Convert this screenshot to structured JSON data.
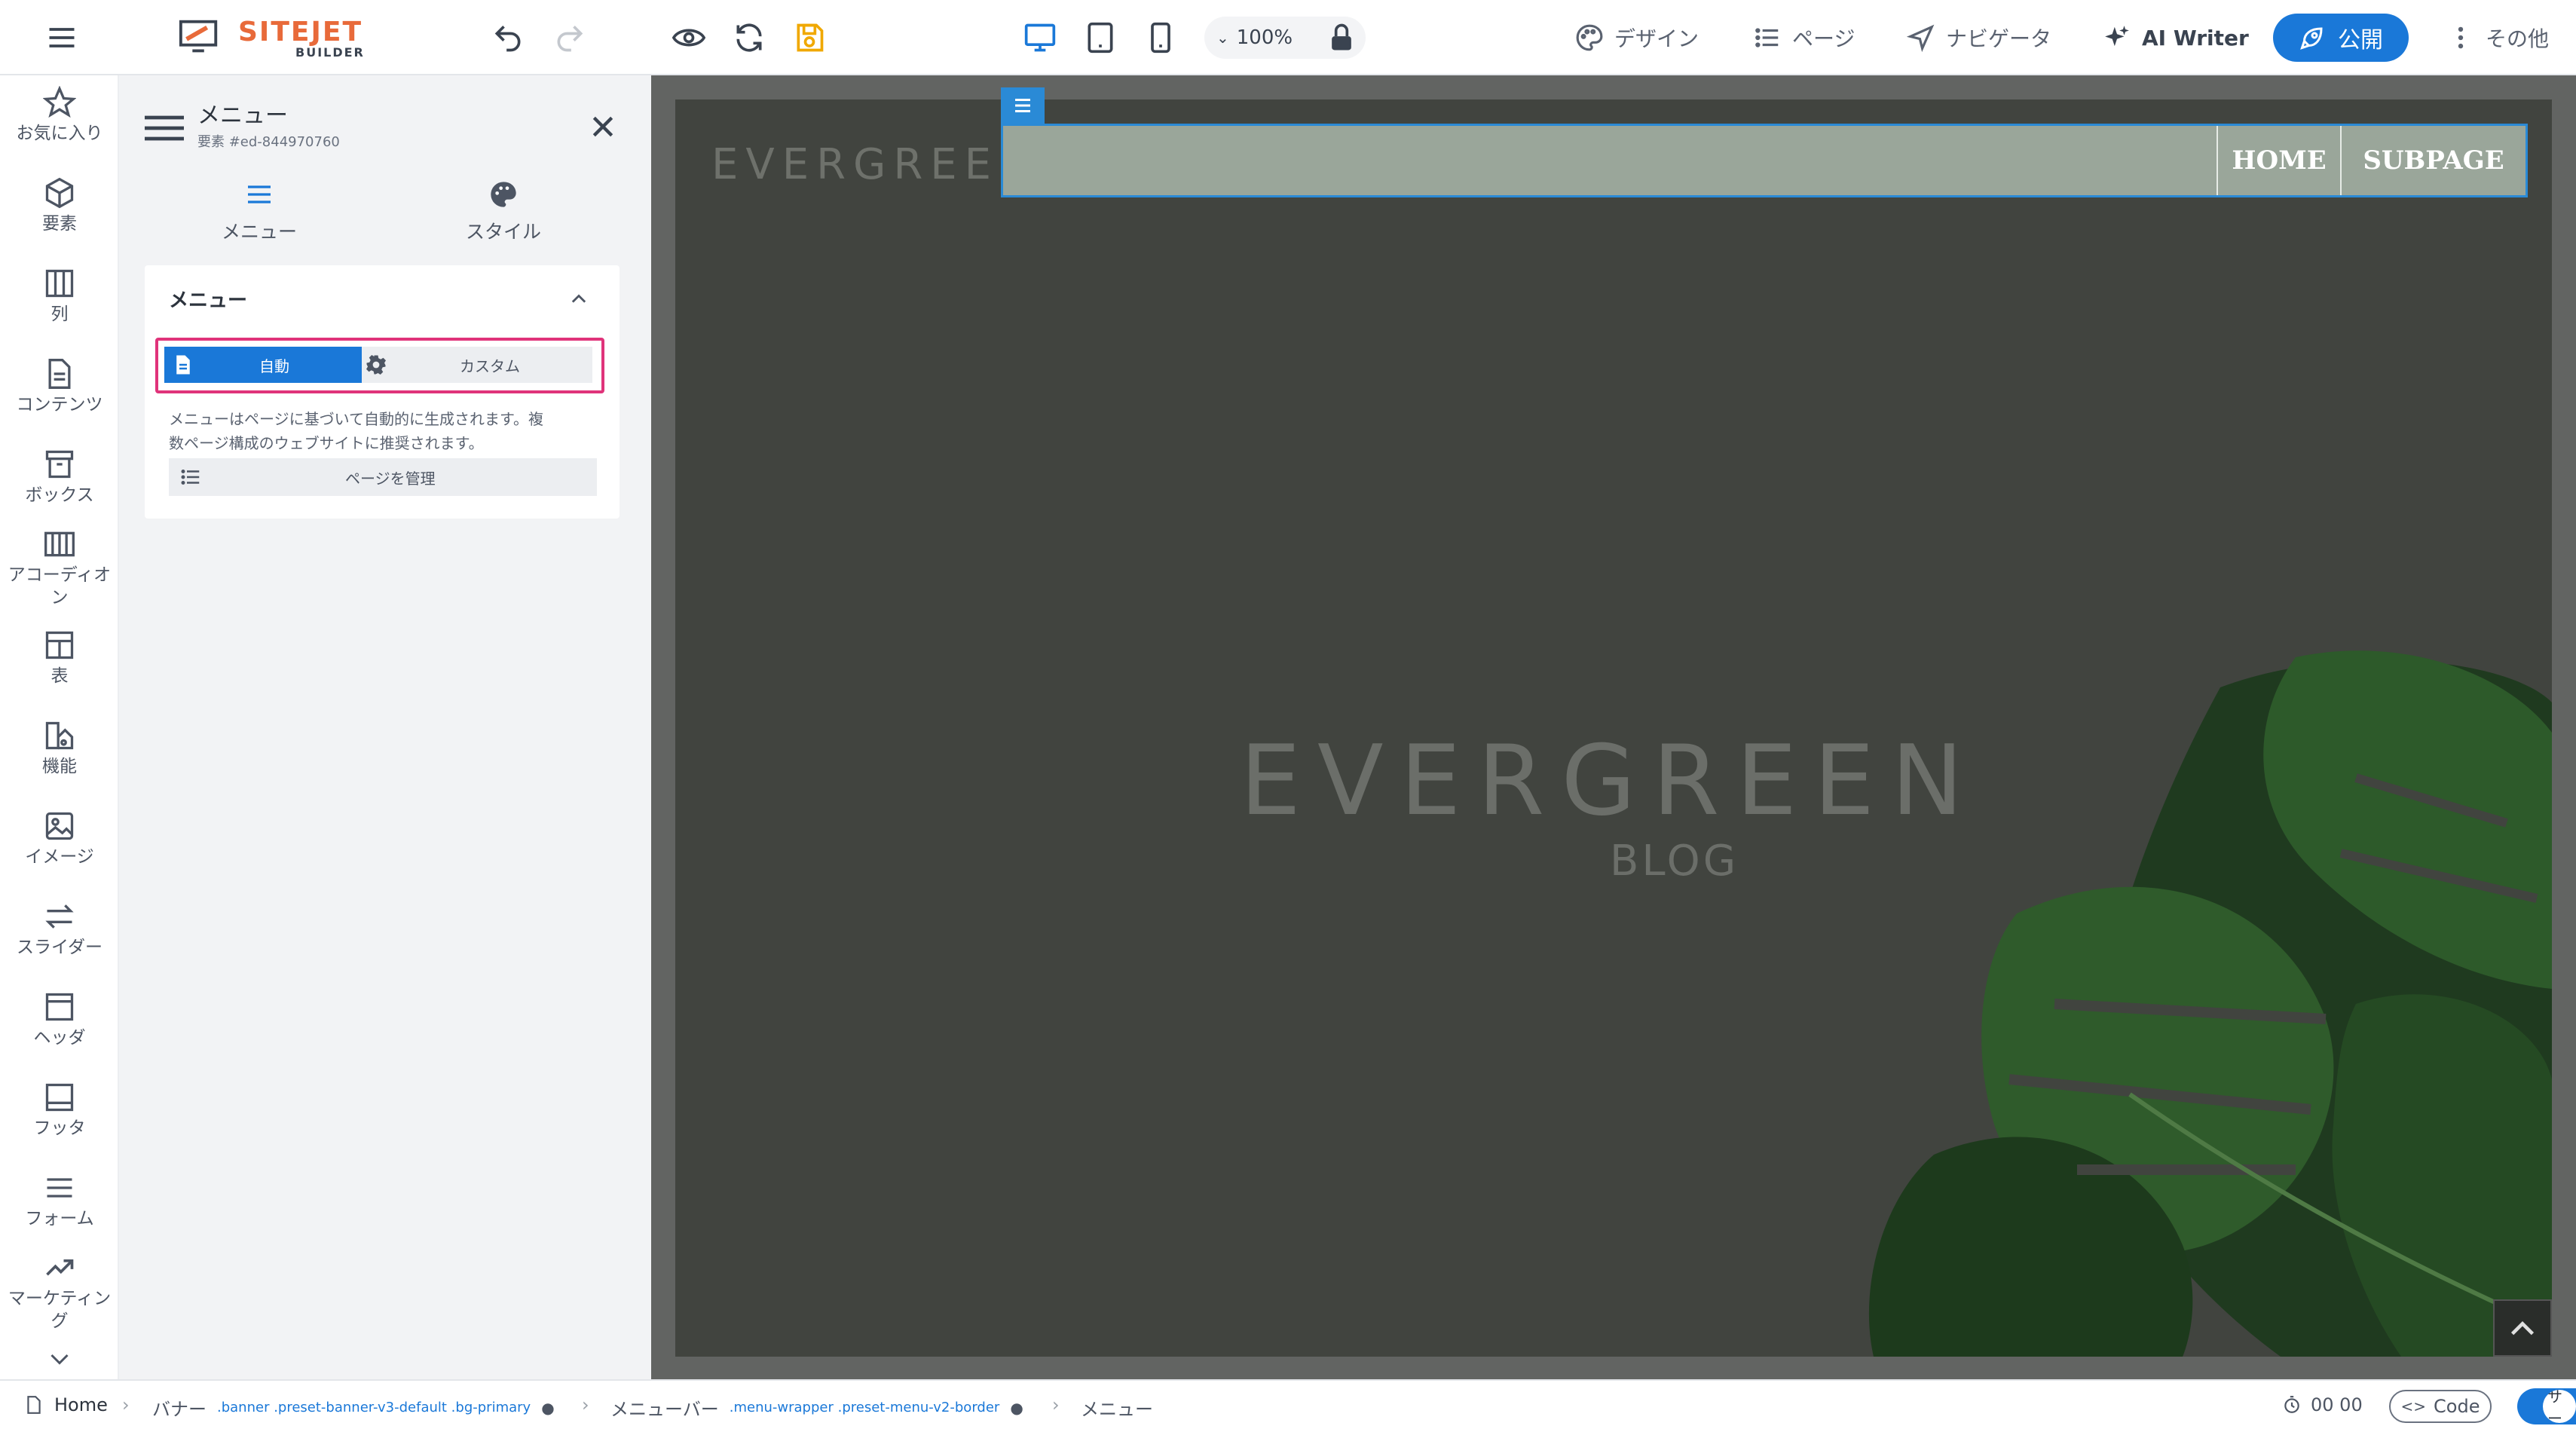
{
  "app": {
    "logo": "SITEJET",
    "logo_sub": "BUILDER"
  },
  "topbar": {
    "zoom": "100%",
    "menu": [
      {
        "label": "デザイン",
        "icon": "palette-icon"
      },
      {
        "label": "ページ",
        "icon": "list-icon"
      },
      {
        "label": "ナビゲータ",
        "icon": "navigator-icon"
      },
      {
        "label": "AI Writer",
        "icon": "sparkle-icon"
      }
    ],
    "publish_label": "公開",
    "more_label": "その他",
    "active_device": "desktop",
    "accent": "#1a78d8"
  },
  "sidebar": {
    "items": [
      {
        "label": "お気に入り",
        "icon": "star-icon"
      },
      {
        "label": "要素",
        "icon": "cube-icon"
      },
      {
        "label": "列",
        "icon": "columns-icon"
      },
      {
        "label": "コンテンツ",
        "icon": "document-icon"
      },
      {
        "label": "ボックス",
        "icon": "box-icon"
      },
      {
        "label": "アコーディオン",
        "icon": "accordion-icon"
      },
      {
        "label": "表",
        "icon": "table-icon"
      },
      {
        "label": "機能",
        "icon": "functions-icon"
      },
      {
        "label": "イメージ",
        "icon": "image-icon"
      },
      {
        "label": "スライダー",
        "icon": "slider-icon"
      },
      {
        "label": "ヘッダ",
        "icon": "header-icon"
      },
      {
        "label": "フッタ",
        "icon": "footer-icon"
      },
      {
        "label": "フォーム",
        "icon": "form-icon"
      },
      {
        "label": "マーケティング",
        "icon": "trend-icon"
      }
    ]
  },
  "panel": {
    "title": "メニュー",
    "subtitle": "要素 #ed-844970760",
    "tabs": [
      {
        "label": "メニュー",
        "icon": "menu-icon",
        "active": true
      },
      {
        "label": "スタイル",
        "icon": "palette-icon",
        "active": false
      }
    ],
    "section_title": "メニュー",
    "mode_auto": "自動",
    "mode_custom": "カスタム",
    "description_line1": "メニューはページに基づいて自動的に生成されます。複",
    "description_line2": "数ページ構成のウェブサイトに推奨されます。",
    "manage_pages": "ページを管理",
    "highlight_color": "#e0337a"
  },
  "canvas": {
    "logo_text": "EVERGREEN",
    "hero_title": "EVERGREEN",
    "hero_subtitle": "BLOG",
    "nav": [
      "HOME",
      "SUBPAGE"
    ],
    "bg_color": "#41443f",
    "menubar_color": "#9aa69a"
  },
  "statusbar": {
    "home": "Home",
    "crumb1": "バナー",
    "crumb1_class": ".banner .preset-banner-v3-default .bg-primary",
    "crumb2": "メニューバー",
    "crumb2_class": ".menu-wrapper .preset-menu-v2-border",
    "crumb3": "メニュー",
    "timer": "00 00",
    "code_label": "Code",
    "support_label": "サー"
  }
}
